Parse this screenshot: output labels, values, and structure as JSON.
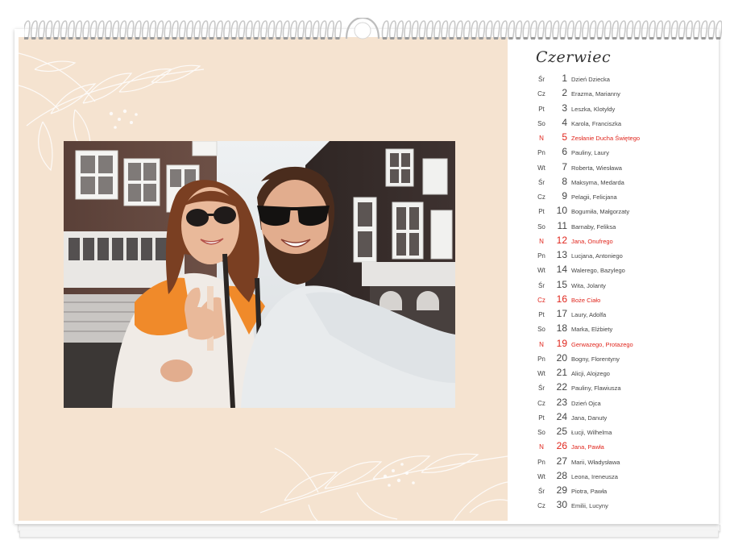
{
  "calendar": {
    "month": "Czerwiec",
    "colors": {
      "background_panel": "#f5e3d0",
      "holiday": "#e0261d"
    },
    "days": [
      {
        "dow": "Śr",
        "day": "1",
        "names": "Dzień Dziecka",
        "holiday": false
      },
      {
        "dow": "Cz",
        "day": "2",
        "names": "Erazma, Marianny",
        "holiday": false
      },
      {
        "dow": "Pt",
        "day": "3",
        "names": "Leszka, Klotyldy",
        "holiday": false
      },
      {
        "dow": "So",
        "day": "4",
        "names": "Karola, Franciszka",
        "holiday": false
      },
      {
        "dow": "N",
        "day": "5",
        "names": "Zesłanie Ducha Świętego",
        "holiday": true
      },
      {
        "dow": "Pn",
        "day": "6",
        "names": "Pauliny, Laury",
        "holiday": false
      },
      {
        "dow": "Wt",
        "day": "7",
        "names": "Roberta, Wiesława",
        "holiday": false
      },
      {
        "dow": "Śr",
        "day": "8",
        "names": "Maksyma, Medarda",
        "holiday": false
      },
      {
        "dow": "Cz",
        "day": "9",
        "names": "Pelagii, Felicjana",
        "holiday": false
      },
      {
        "dow": "Pt",
        "day": "10",
        "names": "Bogumiła, Małgorzaty",
        "holiday": false
      },
      {
        "dow": "So",
        "day": "11",
        "names": "Barnaby, Feliksa",
        "holiday": false
      },
      {
        "dow": "N",
        "day": "12",
        "names": "Jana, Onufrego",
        "holiday": true
      },
      {
        "dow": "Pn",
        "day": "13",
        "names": "Lucjana, Antoniego",
        "holiday": false
      },
      {
        "dow": "Wt",
        "day": "14",
        "names": "Walerego, Bazylego",
        "holiday": false
      },
      {
        "dow": "Śr",
        "day": "15",
        "names": "Wita, Jolanty",
        "holiday": false
      },
      {
        "dow": "Cz",
        "day": "16",
        "names": "Boże Ciało",
        "holiday": true
      },
      {
        "dow": "Pt",
        "day": "17",
        "names": "Laury, Adolfa",
        "holiday": false
      },
      {
        "dow": "So",
        "day": "18",
        "names": "Marka, Elżbiety",
        "holiday": false
      },
      {
        "dow": "N",
        "day": "19",
        "names": "Gerwazego, Protazego",
        "holiday": true
      },
      {
        "dow": "Pn",
        "day": "20",
        "names": "Bogny, Florentyny",
        "holiday": false
      },
      {
        "dow": "Wt",
        "day": "21",
        "names": "Alicji, Alojzego",
        "holiday": false
      },
      {
        "dow": "Śr",
        "day": "22",
        "names": "Pauliny, Flawiusza",
        "holiday": false
      },
      {
        "dow": "Cz",
        "day": "23",
        "names": "Dzień Ojca",
        "holiday": false
      },
      {
        "dow": "Pt",
        "day": "24",
        "names": "Jana, Danuty",
        "holiday": false
      },
      {
        "dow": "So",
        "day": "25",
        "names": "Łucji, Wilhelma",
        "holiday": false
      },
      {
        "dow": "N",
        "day": "26",
        "names": "Jana, Pawła",
        "holiday": true
      },
      {
        "dow": "Pn",
        "day": "27",
        "names": "Marii, Władysława",
        "holiday": false
      },
      {
        "dow": "Wt",
        "day": "28",
        "names": "Leona, Ireneusza",
        "holiday": false
      },
      {
        "dow": "Śr",
        "day": "29",
        "names": "Piotra, Pawła",
        "holiday": false
      },
      {
        "dow": "Cz",
        "day": "30",
        "names": "Emilii, Lucyny",
        "holiday": false
      }
    ]
  }
}
